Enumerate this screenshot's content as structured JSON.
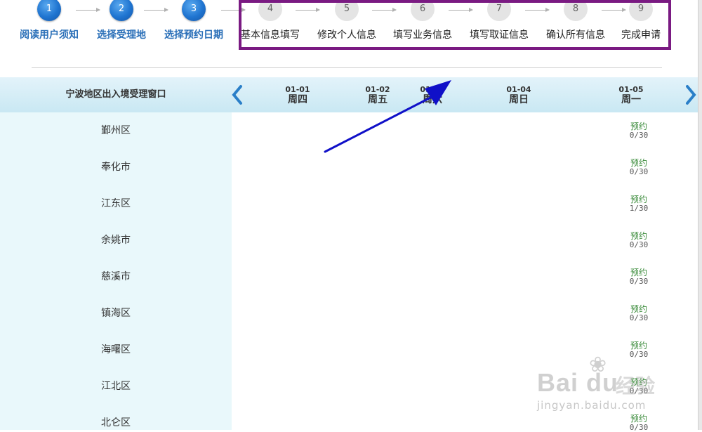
{
  "steps": [
    {
      "number": "1",
      "label": "阅读用户须知",
      "state": "done"
    },
    {
      "number": "2",
      "label": "选择受理地",
      "state": "done"
    },
    {
      "number": "3",
      "label": "选择预约日期",
      "state": "done"
    },
    {
      "number": "4",
      "label": "基本信息填写",
      "state": "todo"
    },
    {
      "number": "5",
      "label": "修改个人信息",
      "state": "todo"
    },
    {
      "number": "6",
      "label": "填写业务信息",
      "state": "todo"
    },
    {
      "number": "7",
      "label": "填写取证信息",
      "state": "todo"
    },
    {
      "number": "8",
      "label": "确认所有信息",
      "state": "todo"
    },
    {
      "number": "9",
      "label": "完成申请",
      "state": "todo"
    }
  ],
  "table": {
    "window_title": "宁波地区出入境受理窗口",
    "days": [
      {
        "date": "01-01",
        "weekday": "周四"
      },
      {
        "date": "01-02",
        "weekday": "周五"
      },
      {
        "date": "01-03",
        "weekday": "周六"
      },
      {
        "date": "01-04",
        "weekday": "周日"
      },
      {
        "date": "01-05",
        "weekday": "周一"
      }
    ],
    "rows": [
      {
        "district": "鄞州区",
        "book_label": "预约",
        "count": "0/30"
      },
      {
        "district": "奉化市",
        "book_label": "预约",
        "count": "0/30"
      },
      {
        "district": "江东区",
        "book_label": "预约",
        "count": "1/30"
      },
      {
        "district": "余姚市",
        "book_label": "预约",
        "count": "0/30"
      },
      {
        "district": "慈溪市",
        "book_label": "预约",
        "count": "0/30"
      },
      {
        "district": "镇海区",
        "book_label": "预约",
        "count": "0/30"
      },
      {
        "district": "海曙区",
        "book_label": "预约",
        "count": "0/30"
      },
      {
        "district": "江北区",
        "book_label": "预约",
        "count": "0/30"
      },
      {
        "district": "北仑区",
        "book_label": "预约",
        "count": "0/30"
      }
    ]
  },
  "watermark": {
    "brand": "Bai du",
    "name": "经验",
    "url": "jingyan.baidu.com"
  },
  "colors": {
    "step_done": "#1f74d0",
    "highlight_box": "#7a1a82",
    "annotation_arrow": "#1010c8",
    "book_link": "#3c8c3c",
    "header_bg": "#d6eef6"
  }
}
